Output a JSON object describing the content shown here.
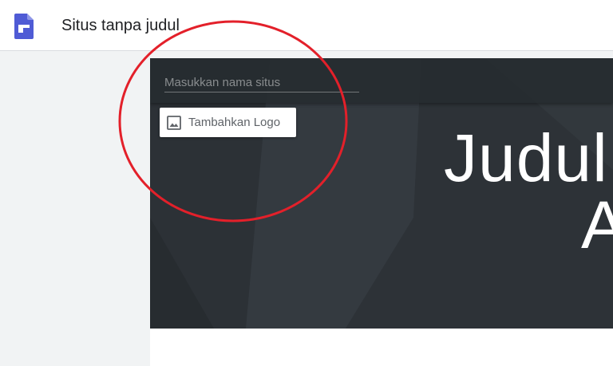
{
  "app": {
    "title": "Situs tanpa judul",
    "logo_icon": "google-sites-icon",
    "logo_color": "#4f5bd5"
  },
  "header": {
    "site_name_placeholder": "Masukkan nama situs",
    "add_logo_label": "Tambahkan Logo",
    "add_logo_icon": "image-icon"
  },
  "hero": {
    "title_line1": "Judul",
    "title_line2": "A",
    "background_color": "#2f353a"
  },
  "annotation": {
    "shape": "ellipse",
    "color": "#e3202a"
  }
}
